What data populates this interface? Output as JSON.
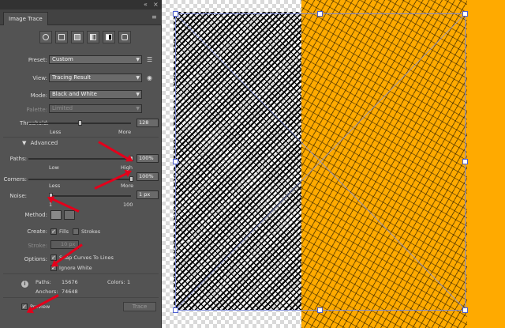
{
  "panel": {
    "title": "Image Trace",
    "controls": {
      "collapse": "«",
      "menu": "≡"
    },
    "preset": {
      "label": "Preset:",
      "value": "Custom"
    },
    "view": {
      "label": "View:",
      "value": "Tracing Result"
    },
    "mode": {
      "label": "Mode:",
      "value": "Black and White"
    },
    "palette": {
      "label": "Palette:",
      "value": "Limited"
    },
    "threshold": {
      "label": "Threshold:",
      "value": "128",
      "min_label": "Less",
      "max_label": "More",
      "level": 0.5
    },
    "advanced": {
      "label": "Advanced"
    },
    "paths": {
      "label": "Paths:",
      "value": "100%",
      "min_label": "Low",
      "max_label": "High",
      "level": 1.0
    },
    "corners": {
      "label": "Corners:",
      "value": "100%",
      "min_label": "Less",
      "max_label": "More",
      "level": 1.0
    },
    "noise": {
      "label": "Noise:",
      "value": "1 px",
      "min_label": "1",
      "max_label": "100",
      "level": 0.0
    },
    "method": {
      "label": "Method:"
    },
    "create": {
      "label": "Create:",
      "fills": "Fills",
      "strokes": "Strokes",
      "fills_checked": true,
      "strokes_checked": false
    },
    "stroke": {
      "label": "Stroke:",
      "value": "10 px"
    },
    "options": {
      "label": "Options:",
      "snap_curves": "Snap Curves To Lines",
      "ignore_white": "Ignore White",
      "snap_checked": true,
      "ignore_checked": true
    },
    "stats": {
      "paths_label": "Paths:",
      "paths_value": "15676",
      "colors_label": "Colors:",
      "colors_value": "1",
      "anchors_label": "Anchors:",
      "anchors_value": "74648"
    },
    "preview": {
      "label": "Preview",
      "checked": true
    },
    "trace_button": "Trace"
  },
  "colors": {
    "panel_bg": "#535353",
    "artwork_orange": "#ffaa00",
    "annotation_red": "#e4001b",
    "selection_blue": "#4d5fd0"
  },
  "icons": [
    "auto-color-icon",
    "high-color-icon",
    "low-color-icon",
    "grayscale-icon",
    "black-white-icon",
    "outline-icon",
    "preset-list-icon",
    "view-eye-icon",
    "info-icon",
    "abutting-method-icon",
    "overlapping-method-icon"
  ]
}
